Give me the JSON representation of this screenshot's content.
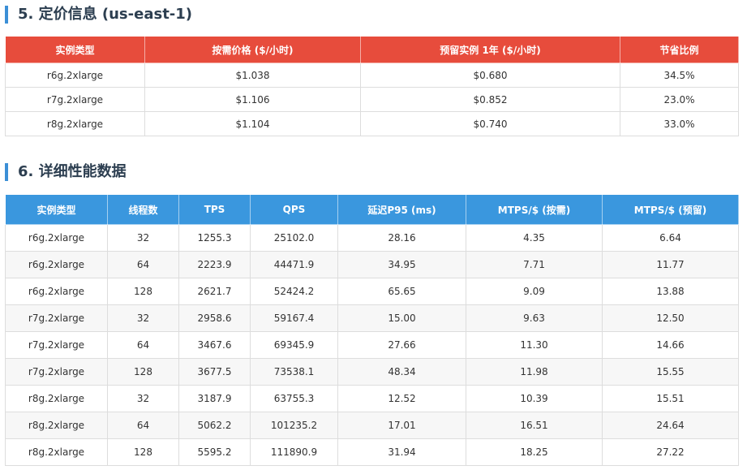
{
  "pricing": {
    "title": "5. 定价信息 (us-east-1)",
    "headers": [
      "实例类型",
      "按需价格 ($/小时)",
      "预留实例 1年 ($/小时)",
      "节省比例"
    ],
    "rows": [
      [
        "r6g.2xlarge",
        "$1.038",
        "$0.680",
        "34.5%"
      ],
      [
        "r7g.2xlarge",
        "$1.106",
        "$0.852",
        "23.0%"
      ],
      [
        "r8g.2xlarge",
        "$1.104",
        "$0.740",
        "33.0%"
      ]
    ]
  },
  "performance": {
    "title": "6. 详细性能数据",
    "headers": [
      "实例类型",
      "线程数",
      "TPS",
      "QPS",
      "延迟P95 (ms)",
      "MTPS/$ (按需)",
      "MTPS/$ (预留)"
    ],
    "rows": [
      [
        "r6g.2xlarge",
        "32",
        "1255.3",
        "25102.0",
        "28.16",
        "4.35",
        "6.64"
      ],
      [
        "r6g.2xlarge",
        "64",
        "2223.9",
        "44471.9",
        "34.95",
        "7.71",
        "11.77"
      ],
      [
        "r6g.2xlarge",
        "128",
        "2621.7",
        "52424.2",
        "65.65",
        "9.09",
        "13.88"
      ],
      [
        "r7g.2xlarge",
        "32",
        "2958.6",
        "59167.4",
        "15.00",
        "9.63",
        "12.50"
      ],
      [
        "r7g.2xlarge",
        "64",
        "3467.6",
        "69345.9",
        "27.66",
        "11.30",
        "14.66"
      ],
      [
        "r7g.2xlarge",
        "128",
        "3677.5",
        "73538.1",
        "48.34",
        "11.98",
        "15.55"
      ],
      [
        "r8g.2xlarge",
        "32",
        "3187.9",
        "63755.3",
        "12.52",
        "10.39",
        "15.51"
      ],
      [
        "r8g.2xlarge",
        "64",
        "5062.2",
        "101235.2",
        "17.01",
        "16.51",
        "24.64"
      ],
      [
        "r8g.2xlarge",
        "128",
        "5595.2",
        "111890.9",
        "31.94",
        "18.25",
        "27.22"
      ]
    ]
  },
  "colors": {
    "pricing_header": "#e74c3c",
    "performance_header": "#3a97de",
    "section_accent": "#3b8fd6"
  }
}
